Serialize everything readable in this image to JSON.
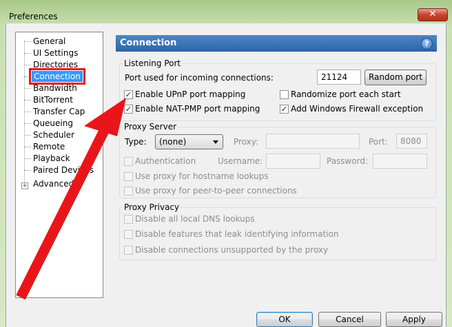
{
  "window": {
    "title": "Preferences",
    "close_glyph": "✕"
  },
  "tree": {
    "items": [
      {
        "label": "General"
      },
      {
        "label": "UI Settings"
      },
      {
        "label": "Directories"
      },
      {
        "label": "Connection"
      },
      {
        "label": "Bandwidth"
      },
      {
        "label": "BitTorrent"
      },
      {
        "label": "Transfer Cap"
      },
      {
        "label": "Queueing"
      },
      {
        "label": "Scheduler"
      },
      {
        "label": "Remote"
      },
      {
        "label": "Playback"
      },
      {
        "label": "Paired Devices"
      },
      {
        "label": "Advanced"
      }
    ],
    "selected": "Connection",
    "expander_glyph": "+"
  },
  "header": {
    "title": "Connection",
    "help_glyph": "?"
  },
  "listening": {
    "label": "Listening Port",
    "port_label": "Port used for incoming connections:",
    "port_value": "21124",
    "random_button": "Random port",
    "upnp": {
      "label": "Enable UPnP port mapping",
      "checked": true
    },
    "natpmp": {
      "label": "Enable NAT-PMP port mapping",
      "checked": true
    },
    "randomize": {
      "label": "Randomize port each start",
      "checked": false
    },
    "firewall": {
      "label": "Add Windows Firewall exception",
      "checked": true
    }
  },
  "proxy": {
    "label": "Proxy Server",
    "type_label": "Type:",
    "type_value": "(none)",
    "proxy_label": "Proxy:",
    "port_label": "Port:",
    "port_value": "8080",
    "auth_label": "Authentication",
    "username_label": "Username:",
    "password_label": "Password:",
    "hostname_label": "Use proxy for hostname lookups",
    "p2p_label": "Use proxy for peer-to-peer connections"
  },
  "privacy": {
    "label": "Proxy Privacy",
    "dns_label": "Disable all local DNS lookups",
    "leak_label": "Disable features that leak identifying information",
    "unsupported_label": "Disable connections unsupported by the proxy"
  },
  "buttons": {
    "ok": "OK",
    "cancel": "Cancel",
    "apply": "Apply"
  },
  "overlay": {
    "arrow_color": "#e8161b",
    "highlight_color": "#e8161b"
  },
  "check_glyph": "✓"
}
